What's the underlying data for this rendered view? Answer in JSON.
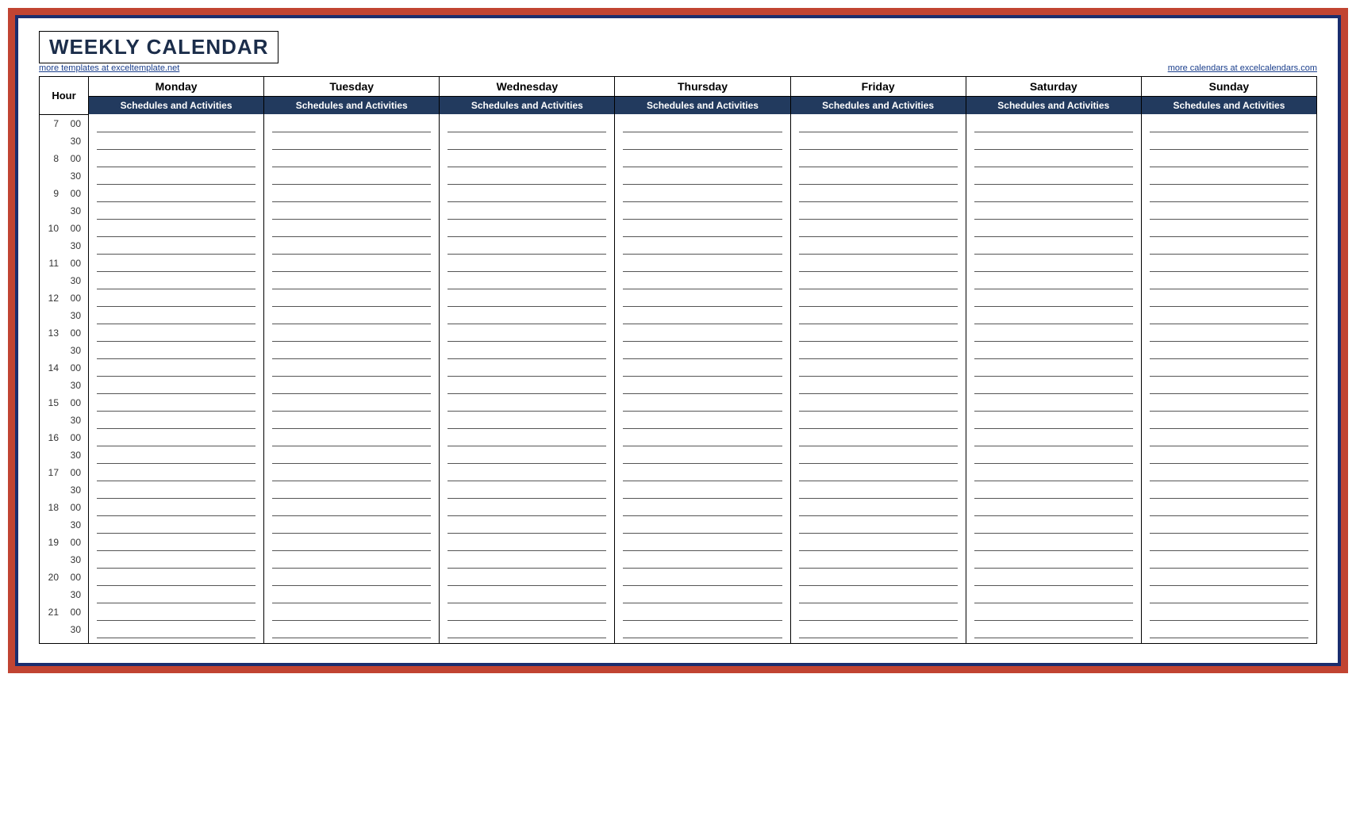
{
  "title": "WEEKLY CALENDAR",
  "links": {
    "left": "more templates at exceltemplate.net",
    "right": "more calendars at excelcalendars.com"
  },
  "headers": {
    "hour": "Hour",
    "days": [
      "Monday",
      "Tuesday",
      "Wednesday",
      "Thursday",
      "Friday",
      "Saturday",
      "Sunday"
    ],
    "subheader": "Schedules and Activities"
  },
  "timeSlots": [
    {
      "hour": "7",
      "min": "00"
    },
    {
      "hour": "",
      "min": "30"
    },
    {
      "hour": "8",
      "min": "00"
    },
    {
      "hour": "",
      "min": "30"
    },
    {
      "hour": "9",
      "min": "00"
    },
    {
      "hour": "",
      "min": "30"
    },
    {
      "hour": "10",
      "min": "00"
    },
    {
      "hour": "",
      "min": "30"
    },
    {
      "hour": "11",
      "min": "00"
    },
    {
      "hour": "",
      "min": "30"
    },
    {
      "hour": "12",
      "min": "00"
    },
    {
      "hour": "",
      "min": "30"
    },
    {
      "hour": "13",
      "min": "00"
    },
    {
      "hour": "",
      "min": "30"
    },
    {
      "hour": "14",
      "min": "00"
    },
    {
      "hour": "",
      "min": "30"
    },
    {
      "hour": "15",
      "min": "00"
    },
    {
      "hour": "",
      "min": "30"
    },
    {
      "hour": "16",
      "min": "00"
    },
    {
      "hour": "",
      "min": "30"
    },
    {
      "hour": "17",
      "min": "00"
    },
    {
      "hour": "",
      "min": "30"
    },
    {
      "hour": "18",
      "min": "00"
    },
    {
      "hour": "",
      "min": "30"
    },
    {
      "hour": "19",
      "min": "00"
    },
    {
      "hour": "",
      "min": "30"
    },
    {
      "hour": "20",
      "min": "00"
    },
    {
      "hour": "",
      "min": "30"
    },
    {
      "hour": "21",
      "min": "00"
    },
    {
      "hour": "",
      "min": "30"
    }
  ]
}
